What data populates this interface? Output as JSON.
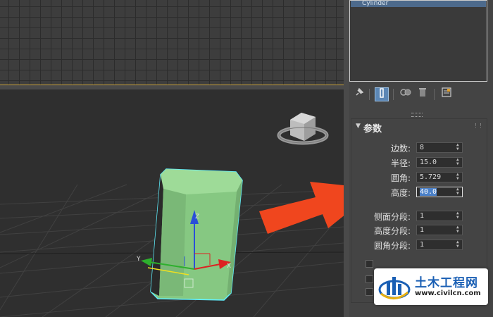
{
  "modifier_stack": {
    "selected_item": "Cylinder"
  },
  "toolbar": {
    "buttons": [
      {
        "name": "pin-stack-icon",
        "glyph": "📌"
      },
      {
        "name": "show-end-result-icon",
        "glyph": "I"
      },
      {
        "name": "make-unique-icon",
        "glyph": "⚯"
      },
      {
        "name": "remove-modifier-icon",
        "glyph": "🗑"
      },
      {
        "name": "configure-modifier-sets-icon",
        "glyph": "⊞"
      }
    ]
  },
  "parameters": {
    "title": "参数",
    "fields": [
      {
        "label": "边数:",
        "value": "8"
      },
      {
        "label": "半径:",
        "value": "15.0"
      },
      {
        "label": "圆角:",
        "value": "5.729"
      },
      {
        "label": "高度:",
        "value": "40.0"
      },
      {
        "label": "侧面分段:",
        "value": "1"
      },
      {
        "label": "高度分段:",
        "value": "1"
      },
      {
        "label": "圆角分段:",
        "value": "1"
      }
    ]
  },
  "viewport": {
    "gizmo_axes": [
      "X",
      "Y",
      "Z"
    ]
  },
  "watermark": {
    "name": "土木工程网",
    "url": "www.civilcn.com"
  },
  "colors": {
    "object_fill": "#8fd08a",
    "selection_outline": "#5ff0ff",
    "arrow": "#f0461e",
    "highlight": "#4a80c8"
  }
}
